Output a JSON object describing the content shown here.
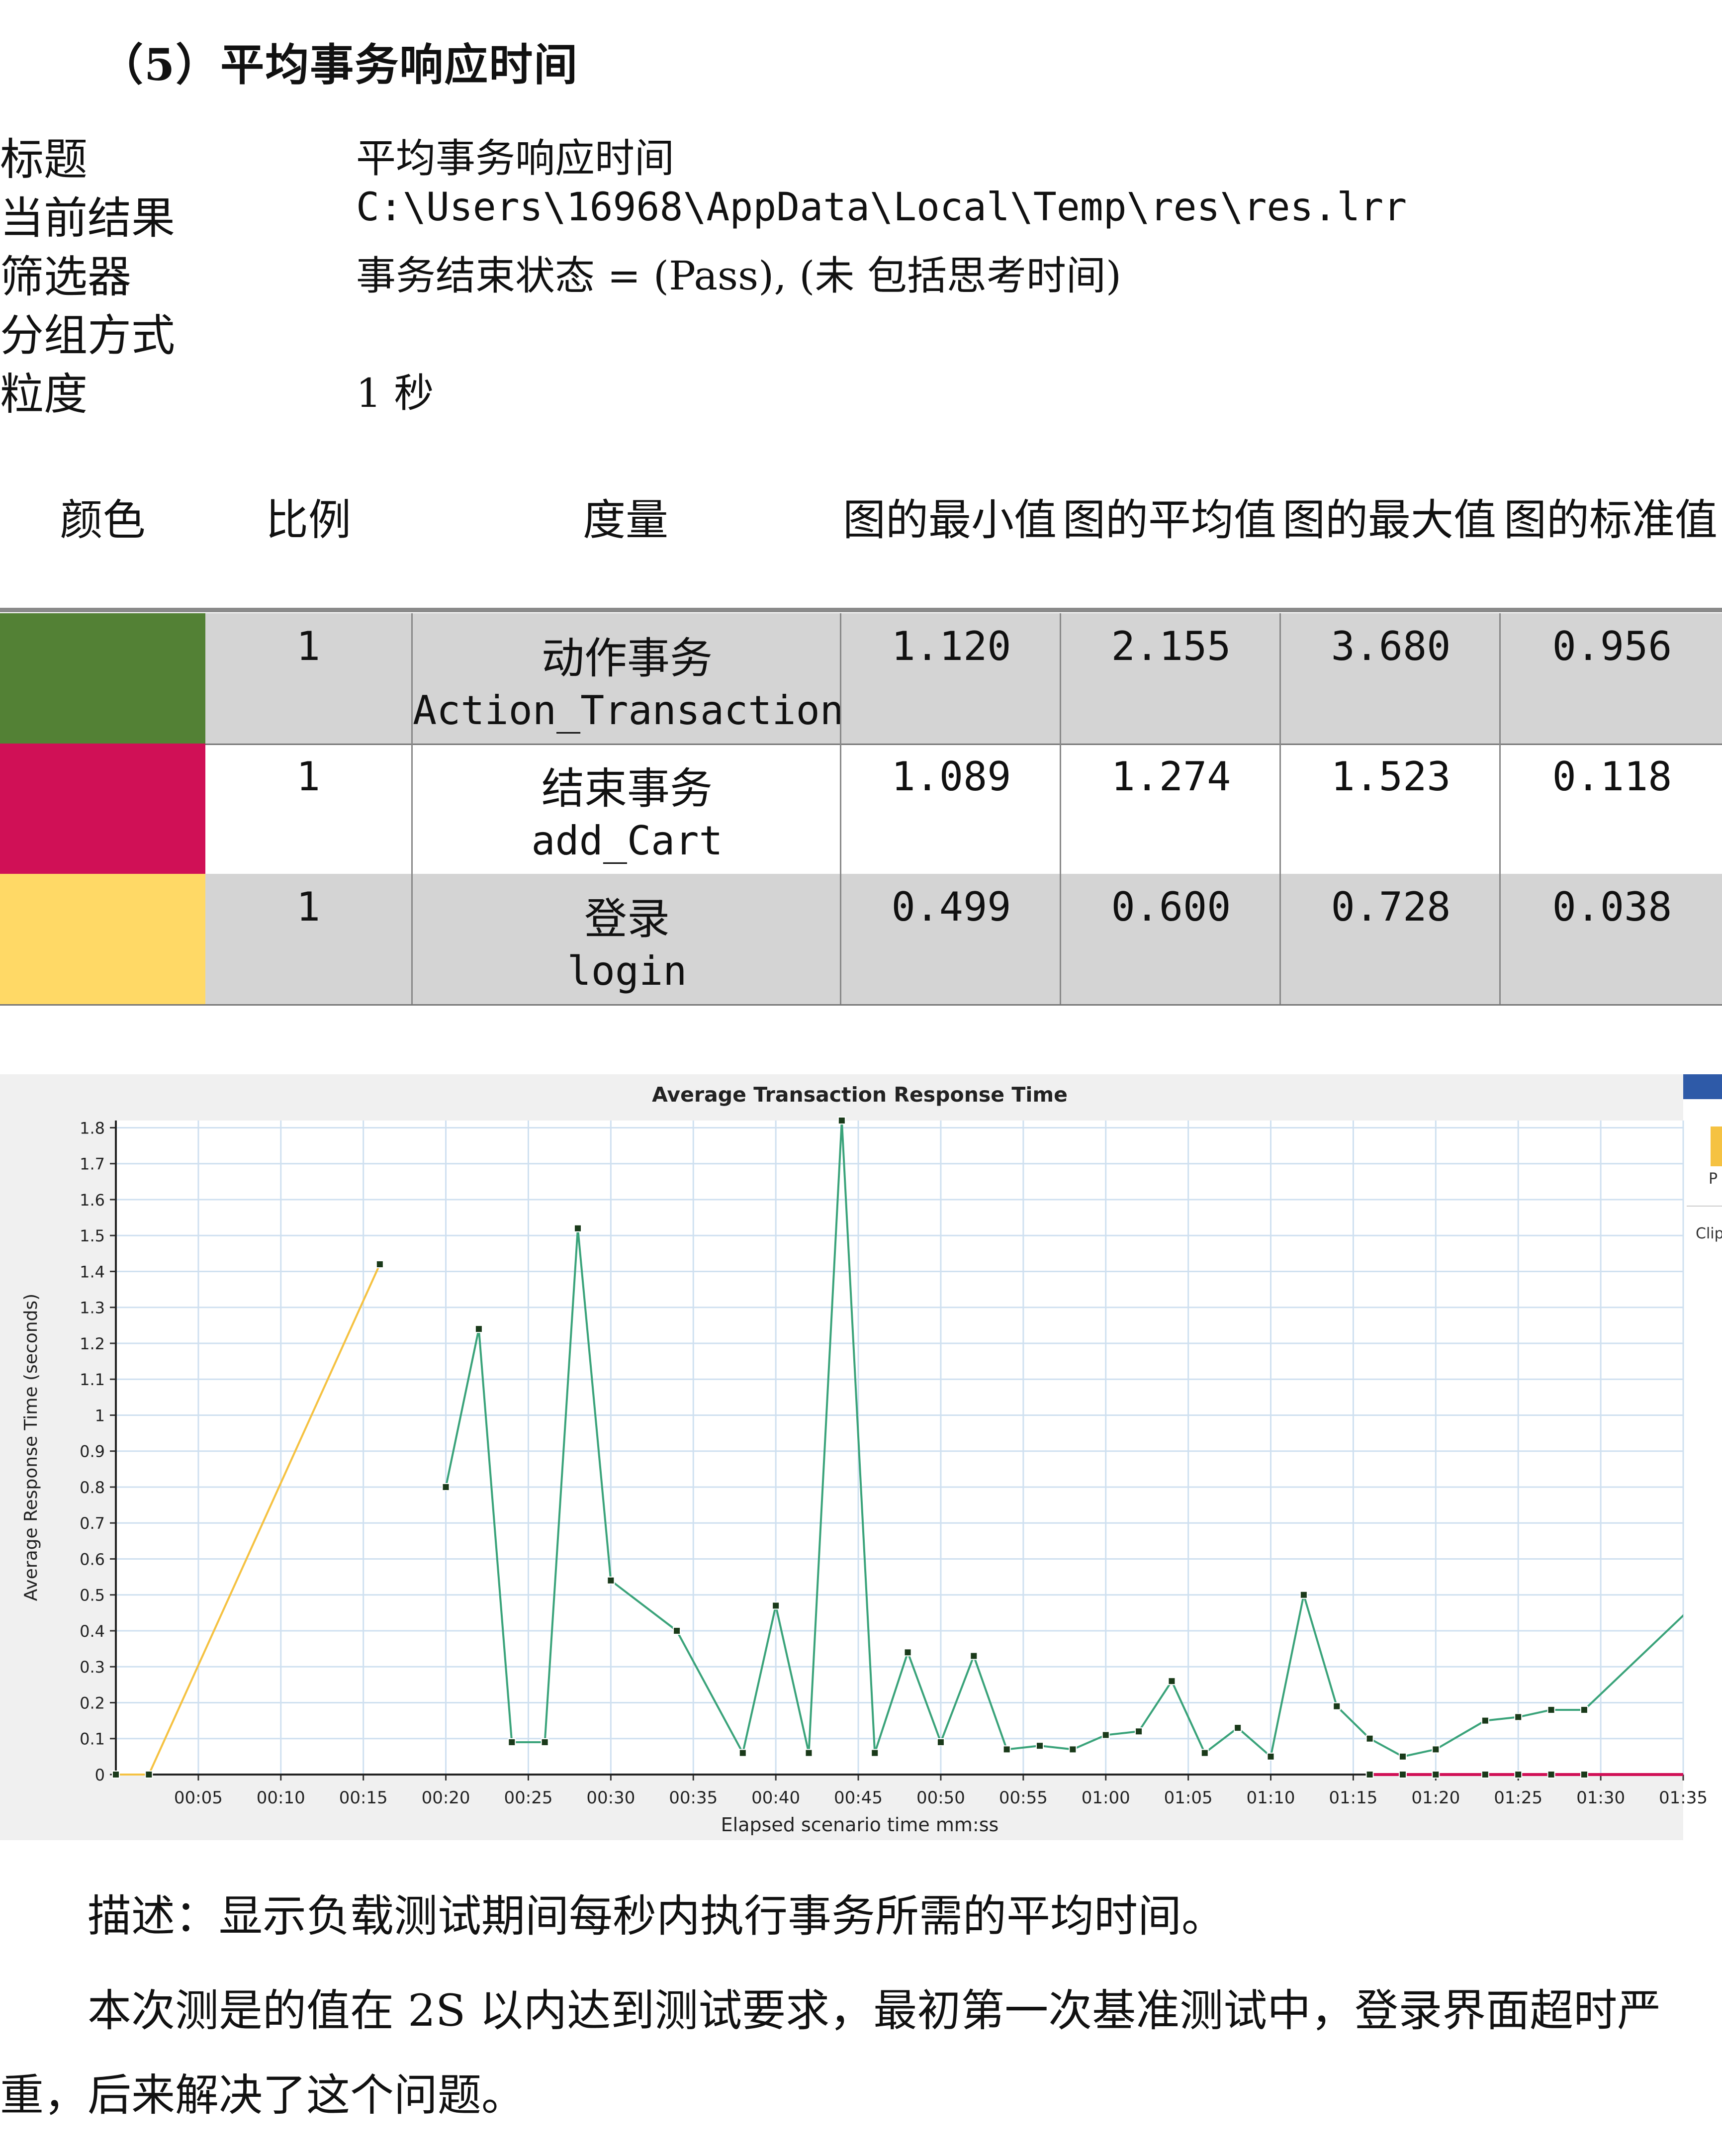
{
  "section_title": "（5）平均事务响应时间",
  "meta": {
    "rows": [
      {
        "key": "标题",
        "value": "平均事务响应时间",
        "mono": false
      },
      {
        "key": "当前结果",
        "value": "C:\\Users\\16968\\AppData\\Local\\Temp\\res\\res.lrr",
        "mono": true
      },
      {
        "key": "筛选器",
        "value": "事务结束状态 = (Pass), (未 包括思考时间)",
        "mono": false
      },
      {
        "key": "分组方式",
        "value": "",
        "mono": false
      },
      {
        "key": "粒度",
        "value": "1 秒",
        "mono": false
      }
    ]
  },
  "table": {
    "headers": [
      "颜色",
      "比例",
      "度量",
      "图的最小值",
      "图的平均值",
      "图的最大值",
      "图的标准值"
    ],
    "rows": [
      {
        "color": "#538135",
        "scale": "1",
        "measure_cn": "动作事务",
        "measure_en": "Action_Transaction",
        "min": "1.120",
        "avg": "2.155",
        "max": "3.680",
        "std": "0.956",
        "shaded": true
      },
      {
        "color": "#d01056",
        "scale": "1",
        "measure_cn": "结束事务",
        "measure_en": "add_Cart",
        "min": "1.089",
        "avg": "1.274",
        "max": "1.523",
        "std": "0.118",
        "shaded": false
      },
      {
        "color": "#ffd966",
        "scale": "1",
        "measure_cn": "登录",
        "measure_en": "login",
        "min": "0.499",
        "avg": "0.600",
        "max": "0.728",
        "std": "0.038",
        "shaded": true
      }
    ]
  },
  "chart_data": {
    "type": "line",
    "title": "Average Transaction Response Time",
    "xlabel": "Elapsed scenario time mm:ss",
    "ylabel": "Average Response Time (seconds)",
    "xlim": [
      0,
      95
    ],
    "ylim": [
      0,
      1.82
    ],
    "x_ticks": [
      5,
      10,
      15,
      20,
      25,
      30,
      35,
      40,
      45,
      50,
      55,
      60,
      65,
      70,
      75,
      80,
      85,
      90,
      95
    ],
    "x_tick_labels": [
      "00:05",
      "00:10",
      "00:15",
      "00:20",
      "00:25",
      "00:30",
      "00:35",
      "00:40",
      "00:45",
      "00:50",
      "00:55",
      "01:00",
      "01:05",
      "01:10",
      "01:15",
      "01:20",
      "01:25",
      "01:30",
      "01:35"
    ],
    "y_ticks": [
      0,
      0.1,
      0.2,
      0.3,
      0.4,
      0.5,
      0.6,
      0.7,
      0.8,
      0.9,
      1,
      1.1,
      1.2,
      1.3,
      1.4,
      1.5,
      1.6,
      1.7,
      1.8
    ],
    "y_tick_labels": [
      "0",
      "0.1",
      "0.2",
      "0.3",
      "0.4",
      "0.5",
      "0.6",
      "0.7",
      "0.8",
      "0.9",
      "1",
      "1.1",
      "1.2",
      "1.3",
      "1.4",
      "1.5",
      "1.6",
      "1.7",
      "1.8"
    ],
    "grid": true,
    "series": [
      {
        "color": "#f5c242",
        "marker": true,
        "x": [
          0,
          2,
          16
        ],
        "y": [
          0,
          0,
          1.42
        ]
      },
      {
        "color": "#3aa37a",
        "marker": true,
        "x": [
          20,
          22,
          24,
          26,
          28,
          30,
          34,
          38,
          40,
          42,
          44,
          46,
          48,
          50,
          52,
          54,
          56,
          58,
          60,
          62,
          64,
          66,
          68,
          70,
          72,
          74,
          76,
          78,
          80,
          83,
          85,
          87,
          89,
          97
        ],
        "y": [
          0.8,
          1.24,
          0.09,
          0.09,
          1.52,
          0.54,
          0.4,
          0.06,
          0.47,
          0.06,
          1.82,
          0.06,
          0.34,
          0.09,
          0.33,
          0.07,
          0.08,
          0.07,
          0.11,
          0.12,
          0.26,
          0.06,
          0.13,
          0.05,
          0.5,
          0.19,
          0.1,
          0.05,
          0.07,
          0.15,
          0.16,
          0.18,
          0.18,
          0.53
        ]
      },
      {
        "color": "#d01056",
        "marker": true,
        "x": [
          76,
          78,
          80,
          83,
          85,
          87,
          89,
          98
        ],
        "y": [
          0,
          0,
          0,
          0,
          0,
          0,
          0,
          0
        ]
      }
    ]
  },
  "paragraphs": {
    "desc": "描述：显示负载测试期间每秒内执行事务所需的平均时间。",
    "body_line1": "本次测是的值在 2S 以内达到测试要求，最初第一次基准测试中，登录界面超时严",
    "body_line2": "重，后来解决了这个问题。"
  },
  "side_panel": {
    "label_p": "P",
    "label_clip": "Clip"
  }
}
